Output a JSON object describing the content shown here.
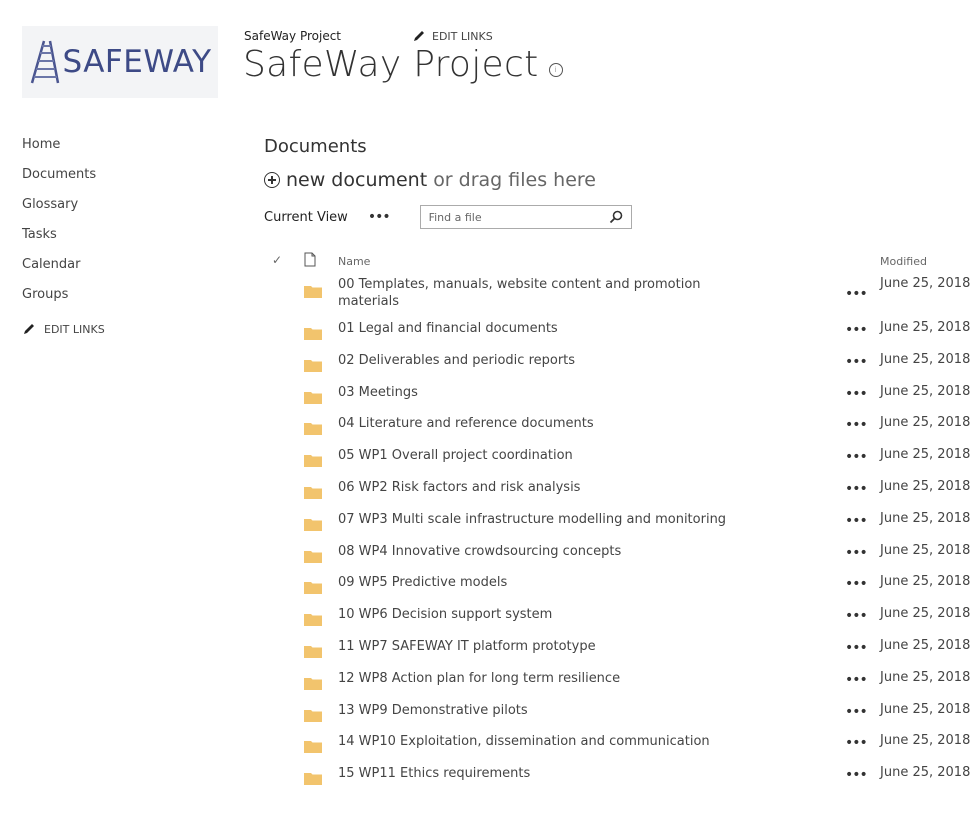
{
  "logo": {
    "text": "SAFEWAY"
  },
  "header": {
    "site_link": "SafeWay Project",
    "edit_links": "EDIT LINKS",
    "title": "SafeWay Project",
    "info_icon": "i"
  },
  "nav": {
    "items": [
      {
        "label": "Home"
      },
      {
        "label": "Documents"
      },
      {
        "label": "Glossary"
      },
      {
        "label": "Tasks"
      },
      {
        "label": "Calendar"
      },
      {
        "label": "Groups"
      }
    ],
    "edit_links": "EDIT LINKS"
  },
  "main": {
    "title": "Documents",
    "new_document": "new document",
    "drag_hint": "or drag files here",
    "current_view": "Current View",
    "view_ellipsis": "•••",
    "search_placeholder": "Find a file",
    "columns": {
      "check": "✓",
      "name": "Name",
      "modified": "Modified"
    }
  },
  "files": [
    {
      "name": "00 Templates, manuals, website content and promotion materials",
      "modified": "June 25, 2018"
    },
    {
      "name": "01 Legal and financial documents",
      "modified": "June 25, 2018"
    },
    {
      "name": "02 Deliverables and periodic reports",
      "modified": "June 25, 2018"
    },
    {
      "name": "03 Meetings",
      "modified": "June 25, 2018"
    },
    {
      "name": "04 Literature and reference documents",
      "modified": "June 25, 2018"
    },
    {
      "name": "05 WP1 Overall project coordination",
      "modified": "June 25, 2018"
    },
    {
      "name": "06 WP2 Risk factors and risk analysis",
      "modified": "June 25, 2018"
    },
    {
      "name": "07 WP3 Multi scale infrastructure modelling and monitoring",
      "modified": "June 25, 2018"
    },
    {
      "name": "08 WP4 Innovative crowdsourcing concepts",
      "modified": "June 25, 2018"
    },
    {
      "name": "09 WP5 Predictive models",
      "modified": "June 25, 2018"
    },
    {
      "name": "10 WP6 Decision support system",
      "modified": "June 25, 2018"
    },
    {
      "name": "11 WP7 SAFEWAY IT platform prototype",
      "modified": "June 25, 2018"
    },
    {
      "name": "12 WP8 Action plan for long term resilience",
      "modified": "June 25, 2018"
    },
    {
      "name": "13 WP9 Demonstrative pilots",
      "modified": "June 25, 2018"
    },
    {
      "name": "14 WP10 Exploitation, dissemination and communication",
      "modified": "June 25, 2018"
    },
    {
      "name": "15 WP11 Ethics requirements",
      "modified": "June 25, 2018"
    }
  ],
  "colors": {
    "folder": "#f2c46d",
    "logo_blue": "#3d4a86",
    "logo_bg": "#f3f4f6"
  }
}
